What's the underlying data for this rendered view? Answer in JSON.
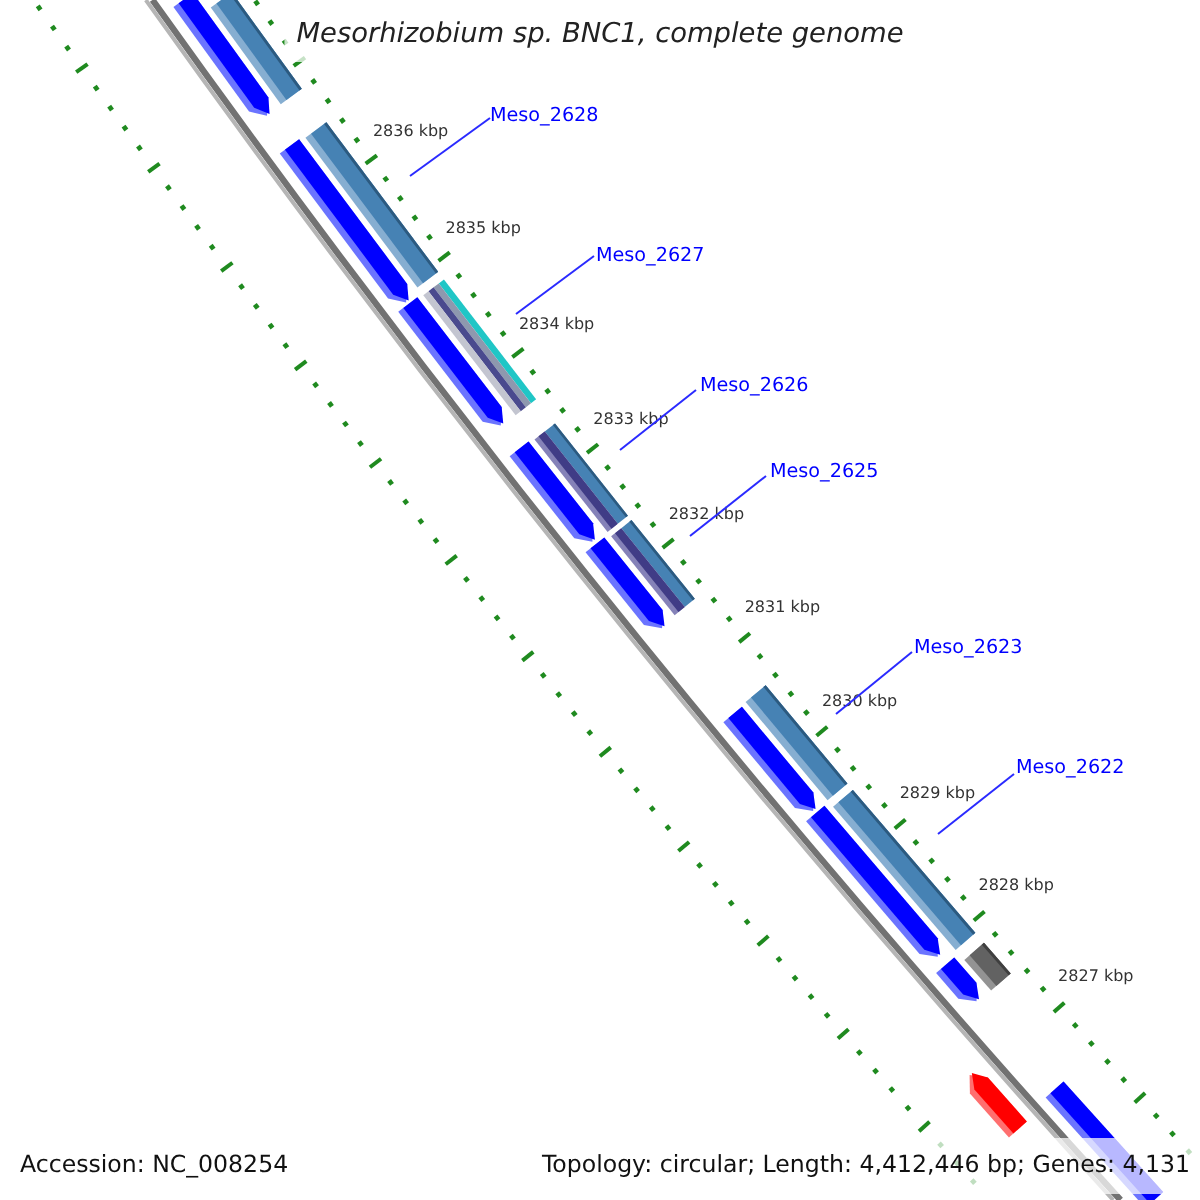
{
  "title": "Mesorhizobium sp. BNC1, complete genome",
  "tick_labels": [
    "2836 kbp",
    "2835 kbp",
    "2834 kbp",
    "2833 kbp",
    "2832 kbp",
    "2831 kbp",
    "2830 kbp",
    "2829 kbp",
    "2828 kbp",
    "2827 kbp"
  ],
  "gene_labels": [
    "Meso_2628",
    "Meso_2627",
    "Meso_2626",
    "Meso_2625",
    "Meso_2623",
    "Meso_2622"
  ],
  "footer": {
    "accession": "Accession: NC_008254",
    "summary": "Topology: circular; Length: 4,412,446 bp; Genes: 4,131"
  }
}
